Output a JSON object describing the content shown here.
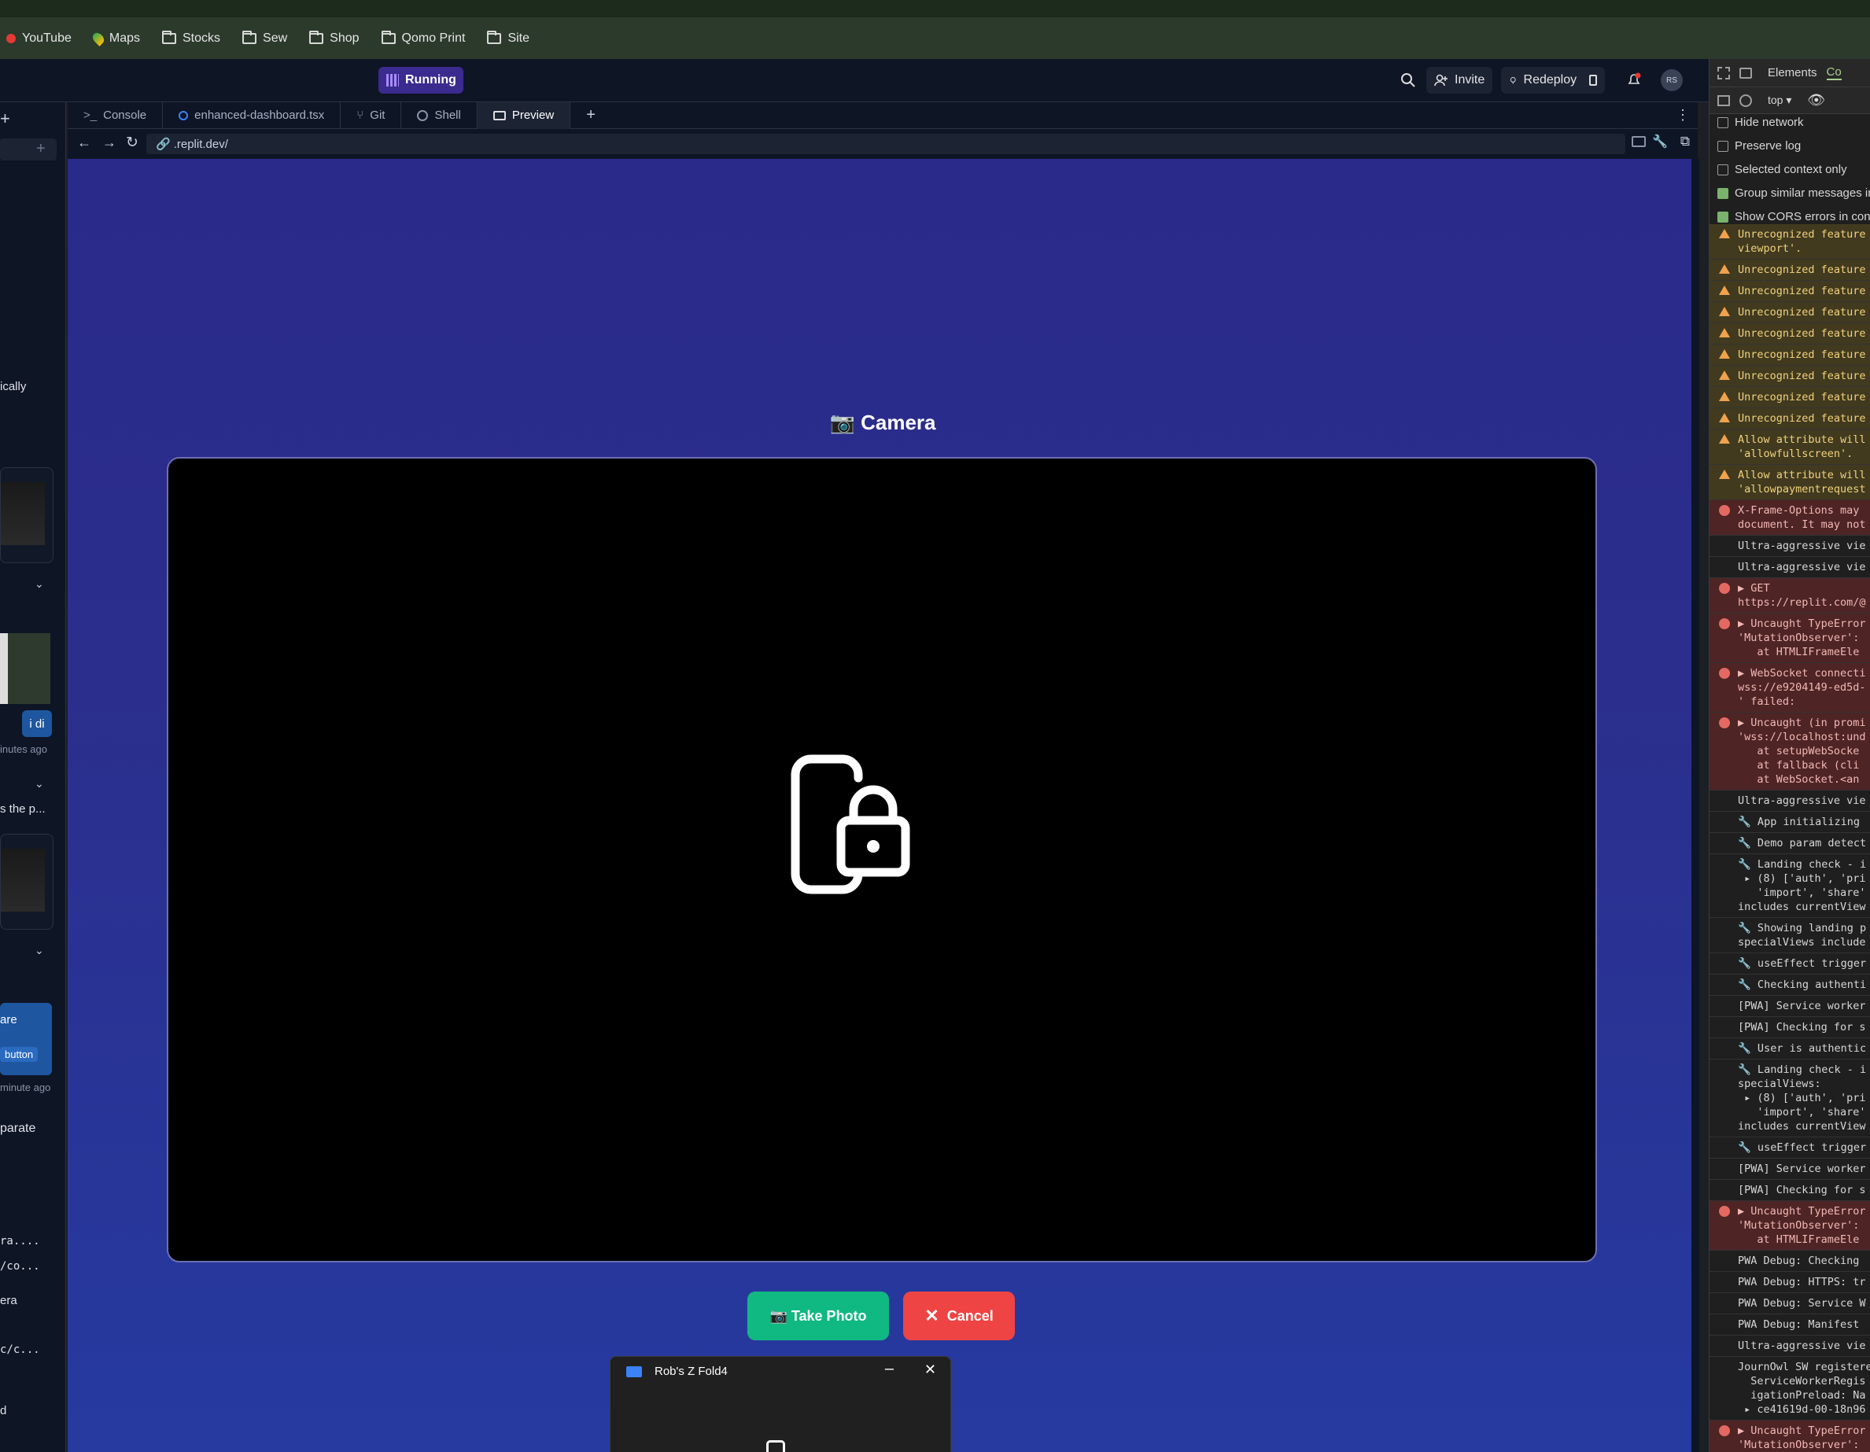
{
  "bookmarks": [
    {
      "label": "YouTube",
      "icon": "youtube-icon"
    },
    {
      "label": "Maps",
      "icon": "maps-icon"
    },
    {
      "label": "Stocks",
      "icon": "folder-icon"
    },
    {
      "label": "Sew",
      "icon": "folder-icon"
    },
    {
      "label": "Shop",
      "icon": "folder-icon"
    },
    {
      "label": "Qomo Print",
      "icon": "folder-icon"
    },
    {
      "label": "Site",
      "icon": "folder-icon"
    }
  ],
  "appbar": {
    "status": "Running",
    "invite": "Invite",
    "redeploy": "Redeploy",
    "avatar": "RS"
  },
  "tabs": [
    {
      "label": "Console",
      "icon": "terminal-icon"
    },
    {
      "label": "enhanced-dashboard.tsx",
      "icon": "file-icon"
    },
    {
      "label": "Git",
      "icon": "git-icon"
    },
    {
      "label": "Shell",
      "icon": "shell-icon"
    },
    {
      "label": "Preview",
      "icon": "preview-icon"
    }
  ],
  "tab_add": "+",
  "url": ".replit.dev/",
  "left_panel": {
    "fragments": [
      "ically",
      "i di",
      "inutes ago",
      "s the p...",
      "are",
      "button",
      "minute ago",
      "parate",
      "ra....",
      "/co...",
      "era",
      "c/c...",
      "d"
    ]
  },
  "camera": {
    "title": "📷 Camera",
    "take_photo": "📷 Take Photo",
    "cancel": "Cancel"
  },
  "popup": {
    "title": "Rob's Z Fold4"
  },
  "devtools": {
    "tab_elements": "Elements",
    "tab_console": "Co",
    "context": "top ▾",
    "options": [
      {
        "label": "Hide network",
        "checked": false
      },
      {
        "label": "Preserve log",
        "checked": false
      },
      {
        "label": "Selected context only",
        "checked": false
      },
      {
        "label": "Group similar messages in",
        "checked": true
      },
      {
        "label": "Show CORS errors in conso",
        "checked": true
      }
    ],
    "logs": [
      {
        "type": "warn",
        "text": "Unrecognized feature\nviewport'."
      },
      {
        "type": "warn",
        "text": "Unrecognized feature"
      },
      {
        "type": "warn",
        "text": "Unrecognized feature"
      },
      {
        "type": "warn",
        "text": "Unrecognized feature"
      },
      {
        "type": "warn",
        "text": "Unrecognized feature"
      },
      {
        "type": "warn",
        "text": "Unrecognized feature"
      },
      {
        "type": "warn",
        "text": "Unrecognized feature"
      },
      {
        "type": "warn",
        "text": "Unrecognized feature"
      },
      {
        "type": "warn",
        "text": "Unrecognized feature"
      },
      {
        "type": "warn",
        "text": "Allow attribute will\n'allowfullscreen'."
      },
      {
        "type": "warn",
        "text": "Allow attribute will\n'allowpaymentrequest"
      },
      {
        "type": "err",
        "text": "X-Frame-Options may\ndocument. It may not"
      },
      {
        "type": "info",
        "text": "Ultra-aggressive vie"
      },
      {
        "type": "info",
        "text": "Ultra-aggressive vie"
      },
      {
        "type": "err",
        "text": "▶ GET\nhttps://replit.com/@"
      },
      {
        "type": "err",
        "text": "▶ Uncaught TypeError\n'MutationObserver':\n   at HTMLIFrameEle"
      },
      {
        "type": "err",
        "text": "▶ WebSocket connecti\nwss://e9204149-ed5d-\n' failed:"
      },
      {
        "type": "err",
        "text": "▶ Uncaught (in promi\n'wss://localhost:und\n   at setupWebSocke\n   at fallback (cli\n   at WebSocket.<an"
      },
      {
        "type": "info",
        "text": "Ultra-aggressive vie"
      },
      {
        "type": "info",
        "text": "🔧 App initializing"
      },
      {
        "type": "info",
        "text": "🔧 Demo param detect"
      },
      {
        "type": "info",
        "text": "🔧 Landing check - i\n ▸ (8) ['auth', 'pri\n   'import', 'share'\nincludes currentView"
      },
      {
        "type": "info",
        "text": "🔧 Showing landing p\nspecialViews include"
      },
      {
        "type": "info",
        "text": "🔧 useEffect trigger"
      },
      {
        "type": "info",
        "text": "🔧 Checking authenti"
      },
      {
        "type": "info",
        "text": "[PWA] Service worker"
      },
      {
        "type": "info",
        "text": "[PWA] Checking for s"
      },
      {
        "type": "info",
        "text": "🔧 User is authentic"
      },
      {
        "type": "info",
        "text": "🔧 Landing check - i\nspecialViews:\n ▸ (8) ['auth', 'pri\n   'import', 'share'\nincludes currentView"
      },
      {
        "type": "info",
        "text": "🔧 useEffect trigger"
      },
      {
        "type": "info",
        "text": "[PWA] Service worker"
      },
      {
        "type": "info",
        "text": "[PWA] Checking for s"
      },
      {
        "type": "err",
        "text": "▶ Uncaught TypeError\n'MutationObserver':\n   at HTMLIFrameEle"
      },
      {
        "type": "info",
        "text": "PWA Debug: Checking"
      },
      {
        "type": "info",
        "text": "PWA Debug: HTTPS: tr"
      },
      {
        "type": "info",
        "text": "PWA Debug: Service W"
      },
      {
        "type": "info",
        "text": "PWA Debug: Manifest"
      },
      {
        "type": "info",
        "text": "Ultra-aggressive vie"
      },
      {
        "type": "info",
        "text": "JournOwl SW registere\n  ServiceWorkerRegis\n  igationPreload: Na\n ▸ ce41619d-00-18n96"
      },
      {
        "type": "err",
        "text": "▶ Uncaught TypeError\n'MutationObserver':\n   at HTMLIFrameEle"
      }
    ]
  }
}
